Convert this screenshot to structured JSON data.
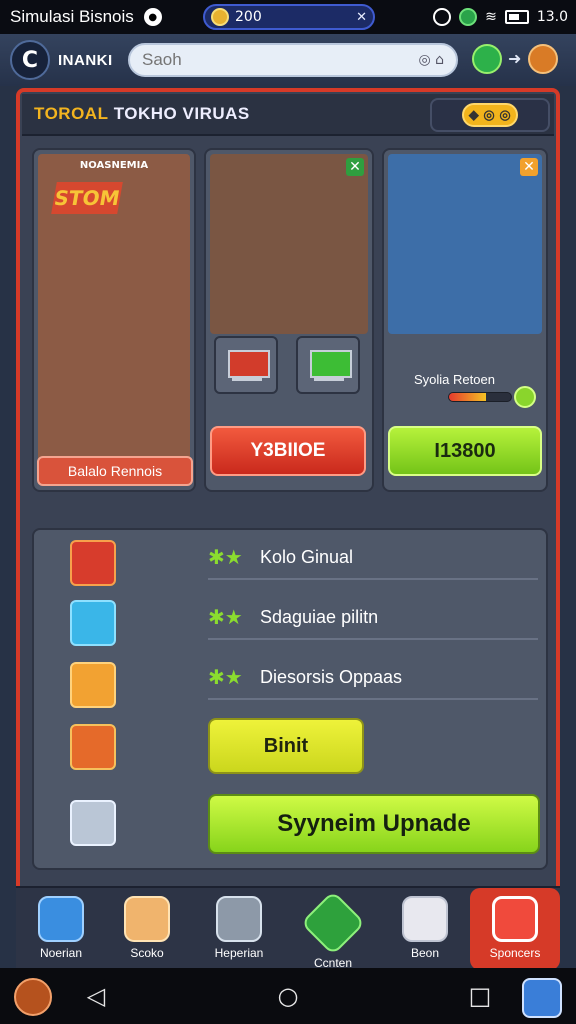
{
  "status": {
    "app_name": "Simulasi Bisnois",
    "coins": "200",
    "time": "13.0"
  },
  "top": {
    "brand": "INANKI",
    "search_placeholder": "Saoh"
  },
  "header": {
    "title_highlight": "TOROAL",
    "title_rest": "TOKHO VIRUAS"
  },
  "cards": {
    "left": {
      "top_label": "NOASNEMIA",
      "sign": "STOM",
      "bottom_label": "Balalo Rennois"
    },
    "middle": {
      "button_label": "Y3BIIOE"
    },
    "right": {
      "status_label": "Syolia Retoen",
      "progress": 0.6,
      "button_label": "I13800"
    }
  },
  "panel": {
    "rows": [
      {
        "label": "Kolo Ginual"
      },
      {
        "label": "Sdaguiae pilitn"
      },
      {
        "label": "Diesorsis Oppaas"
      }
    ],
    "small_button": "Binit",
    "upgrade_button": "Syyneim Upnade"
  },
  "nav": {
    "items": [
      {
        "label": "Noerian",
        "icon": "camera-icon"
      },
      {
        "label": "Scoko",
        "icon": "box-icon"
      },
      {
        "label": "Heperian",
        "icon": "trash-icon"
      },
      {
        "label": "Ccnten",
        "icon": "diamond-icon"
      },
      {
        "label": "Beon",
        "icon": "document-icon"
      },
      {
        "label": "Sponcers",
        "icon": "speaker-icon"
      }
    ]
  },
  "colors": {
    "accent_red": "#d63a28",
    "accent_yellow": "#f3b41f",
    "accent_green": "#87d41b"
  }
}
